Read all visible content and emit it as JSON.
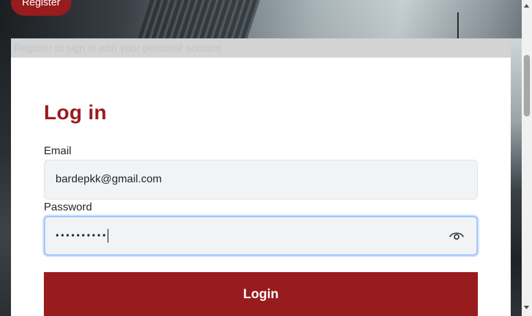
{
  "header": {
    "register_label": "Register",
    "subtitle": "Register to sign in with your personal account"
  },
  "form": {
    "title": "Log in",
    "email_label": "Email",
    "email_value": "bardepkk@gmail.com",
    "password_label": "Password",
    "password_masked": "••••••••••",
    "login_label": "Login"
  },
  "icons": {
    "password_toggle": "eye-icon"
  },
  "colors": {
    "brand": "#981b1e",
    "focus_border": "#9ec5fe",
    "input_bg": "#f1f3f5"
  }
}
